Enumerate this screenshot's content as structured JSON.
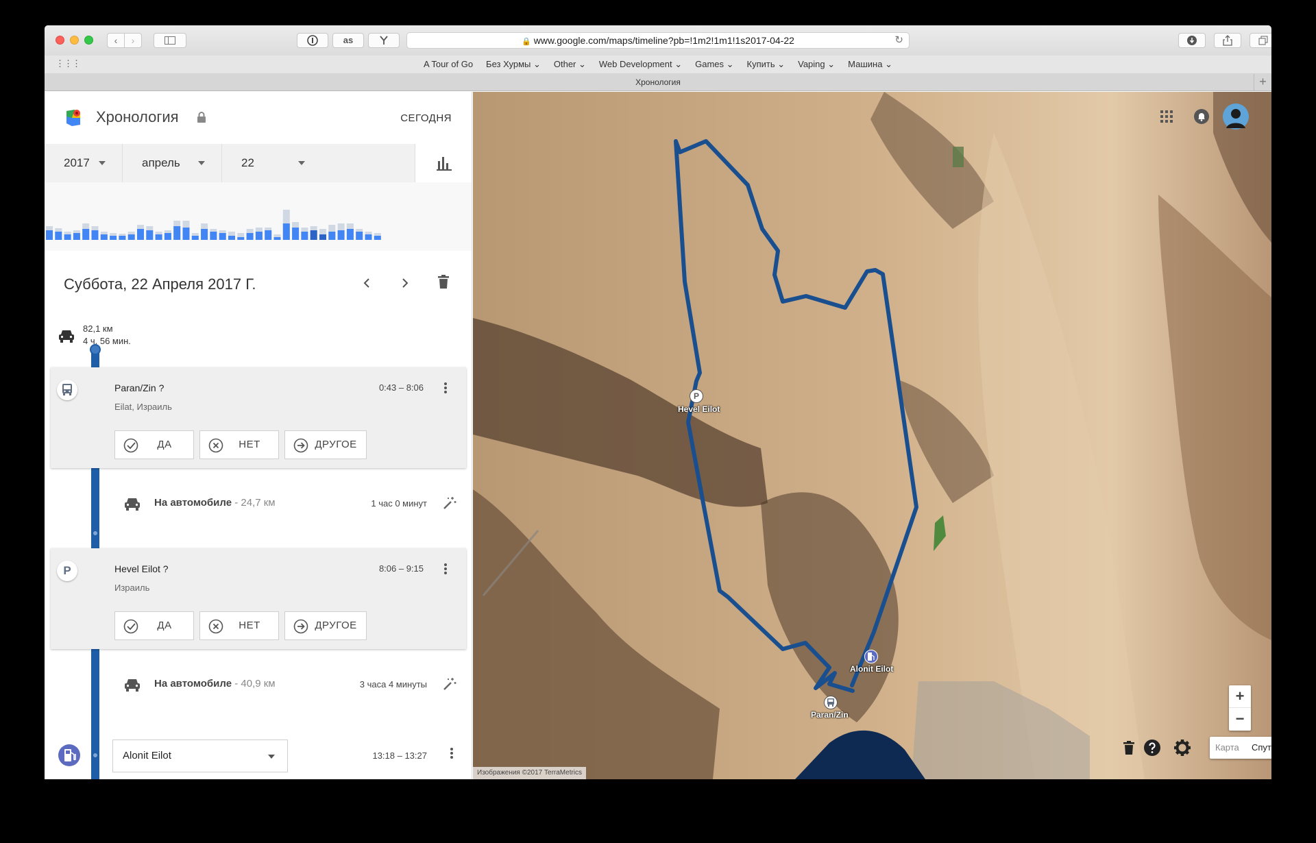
{
  "browser": {
    "url": "www.google.com/maps/timeline?pb=!1m2!1m1!1s2017-04-22",
    "tab_title": "Хронология",
    "ext_lastfm": "as",
    "bookmarks": [
      "A Tour of Go",
      "Без Хурмы ⌄",
      "Other ⌄",
      "Web Development ⌄",
      "Games ⌄",
      "Купить ⌄",
      "Vaping ⌄",
      "Машина ⌄"
    ]
  },
  "header": {
    "title": "Хронология",
    "today_label": "СЕГОДНЯ"
  },
  "date_picker": {
    "year": "2017",
    "month": "апрель",
    "day": "22"
  },
  "histogram": {
    "colors": {
      "past": "#cfd8e3",
      "active": "#4285f4",
      "selected": "#2b63c6"
    }
  },
  "day": {
    "title": "Суббота, 22 Апреля 2017 Г."
  },
  "summary": {
    "distance": "82,1 км",
    "duration": "4 ч. 56 мин."
  },
  "visits": [
    {
      "name": "Paran/Zin ?",
      "subtitle": "Eilat, Израиль",
      "time": "0:43 – 8:06",
      "icon": "bus-icon",
      "yes": "ДА",
      "no": "НЕТ",
      "other": "ДРУГОЕ"
    },
    {
      "name": "Hevel Eilot ?",
      "subtitle": "Израиль",
      "time": "8:06 – 9:15",
      "icon": "parking-icon",
      "icon_text": "P",
      "yes": "ДА",
      "no": "НЕТ",
      "other": "ДРУГОЕ"
    }
  ],
  "moves": [
    {
      "mode": "На автомобиле",
      "distance": " - 24,7 км",
      "duration": "1 час 0 минут"
    },
    {
      "mode": "На автомобиле",
      "distance": " - 40,9 км",
      "duration": "3 часа 4 минуты"
    }
  ],
  "last_visit": {
    "name": "Alonit Eilot",
    "time": "13:18 – 13:27"
  },
  "map": {
    "labels": {
      "hevel": "Hevel Eilot",
      "alonit": "Alonit Eilot",
      "paran": "Paran/Zin"
    },
    "pin_parking": "P",
    "zoom_in": "+",
    "zoom_out": "−",
    "type_map": "Карта",
    "type_satellite": "Спутник",
    "credit": "Изображения ©2017 TerraMetrics",
    "route_color": "#1a4f8f"
  }
}
